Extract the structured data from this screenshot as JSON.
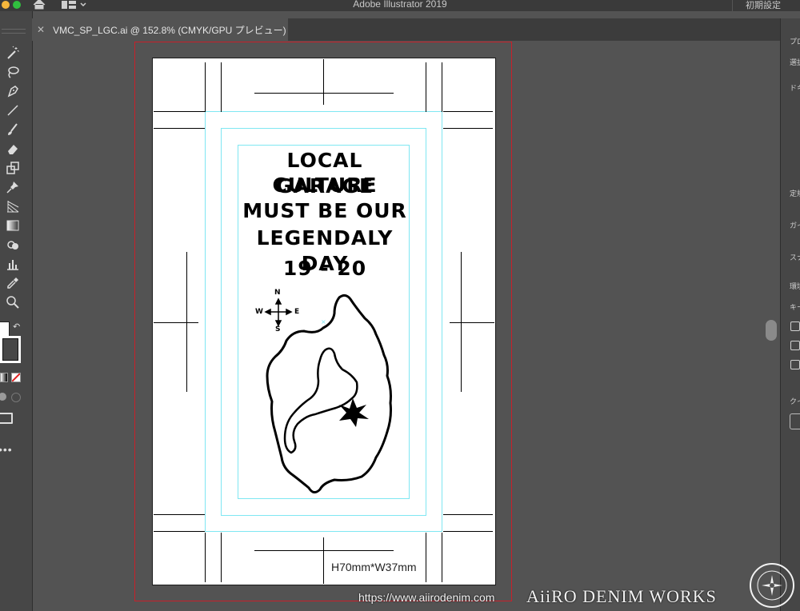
{
  "app": {
    "title": "Adobe Illustrator 2019",
    "workspace_preset": "初期設定"
  },
  "colors": {
    "accent_guide": "#7fe7f2",
    "bleed": "#c8202a",
    "window_bg": "#535353"
  },
  "document_tab": {
    "name": "VMC_SP_LGC.ai @ 152.8% (CMYK/GPU プレビュー)",
    "close_icon": "close-icon"
  },
  "toolbar": {
    "tools": [
      "magic-wand-icon",
      "lasso-icon",
      "pen-icon",
      "line-icon",
      "paintbrush-icon",
      "eraser-icon",
      "scale-icon",
      "pin-icon",
      "perspective-grid-icon",
      "gradient-icon",
      "shape-builder-icon",
      "graph-icon",
      "eyedropper-icon",
      "zoom-icon"
    ]
  },
  "right_panel": {
    "labels": [
      "プロ",
      "選択",
      "ドキ",
      "定規",
      "ガイ",
      "スナ",
      "環境",
      "キー",
      "クイ"
    ]
  },
  "artwork": {
    "headline": [
      "LOCAL GARAGE",
      "CULTURE",
      "MUST BE OUR",
      "LEGENDALY DAY",
      "19 - 20"
    ],
    "compass": {
      "n": "N",
      "s": "S",
      "e": "E",
      "w": "W"
    },
    "size_note": "H70mm*W37mm"
  },
  "watermark": {
    "url": "https://www.aiirodenim.com",
    "brand": "AiiRO DENIM WORKS"
  }
}
